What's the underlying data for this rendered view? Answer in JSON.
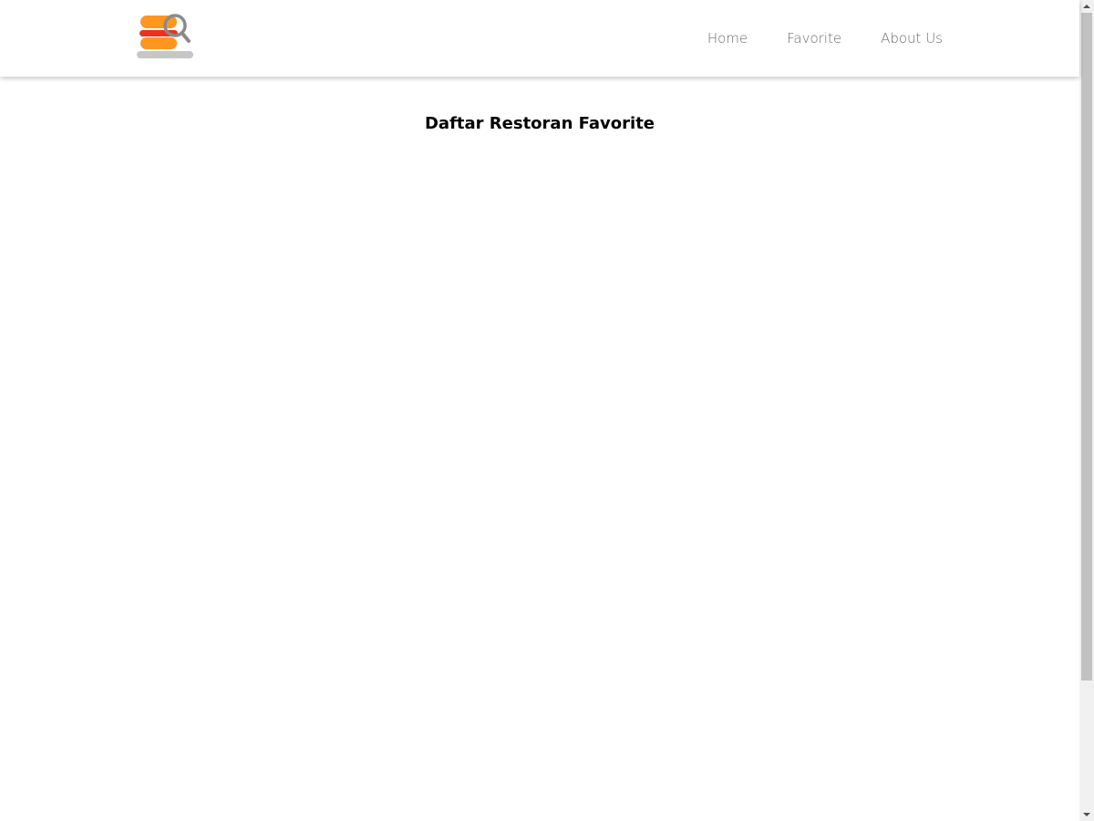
{
  "header": {
    "logo_icon": "burger-search-logo",
    "nav": [
      {
        "label": "Home"
      },
      {
        "label": "Favorite"
      },
      {
        "label": "About Us"
      }
    ]
  },
  "main": {
    "title": "Daftar Restoran Favorite"
  },
  "colors": {
    "bun": "#ff9620",
    "patty": "#e8331e",
    "plate": "#c6c6c6",
    "magnifier": "#8a8a8a",
    "nav_text": "#6b6b6b"
  }
}
